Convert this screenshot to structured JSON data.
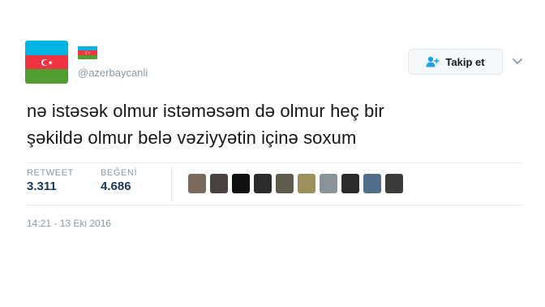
{
  "user": {
    "handle": "@azerbaycanli",
    "avatar_icon": "azerbaijan-flag-icon",
    "name_badge_icon": "azerbaijan-flag-icon"
  },
  "follow": {
    "label": "Takip et",
    "icon": "add-user-icon"
  },
  "menu_icon": "chevron-down-icon",
  "tweet": {
    "line1": "nə istəsək olmur istəməsəm də olmur heç bir",
    "line2": "şəkildə olmur belə vəziyyətin içinə soxum"
  },
  "stats": {
    "retweets_label": "RETWEET",
    "retweets_count": "3.311",
    "likes_label": "BEĞENİ",
    "likes_count": "4.686"
  },
  "liker_avatars": [
    {
      "color": "#7a6a5e"
    },
    {
      "color": "#4a4240"
    },
    {
      "color": "#111111"
    },
    {
      "color": "#2c2c2c"
    },
    {
      "color": "#5e5b4c"
    },
    {
      "color": "#9b8f5b"
    },
    {
      "color": "#8a9398"
    },
    {
      "color": "#2e2b2b"
    },
    {
      "color": "#4f6f8a"
    },
    {
      "color": "#3b3b3b"
    }
  ],
  "timestamp": "14:21 - 13 Eki 2016",
  "colors": {
    "flag_blue": "#00b5e2",
    "flag_red": "#ef3340",
    "flag_green": "#509e2f",
    "muted_text": "#8899a6",
    "count_text": "#1b3a5a",
    "follow_icon": "#1da1f2"
  }
}
